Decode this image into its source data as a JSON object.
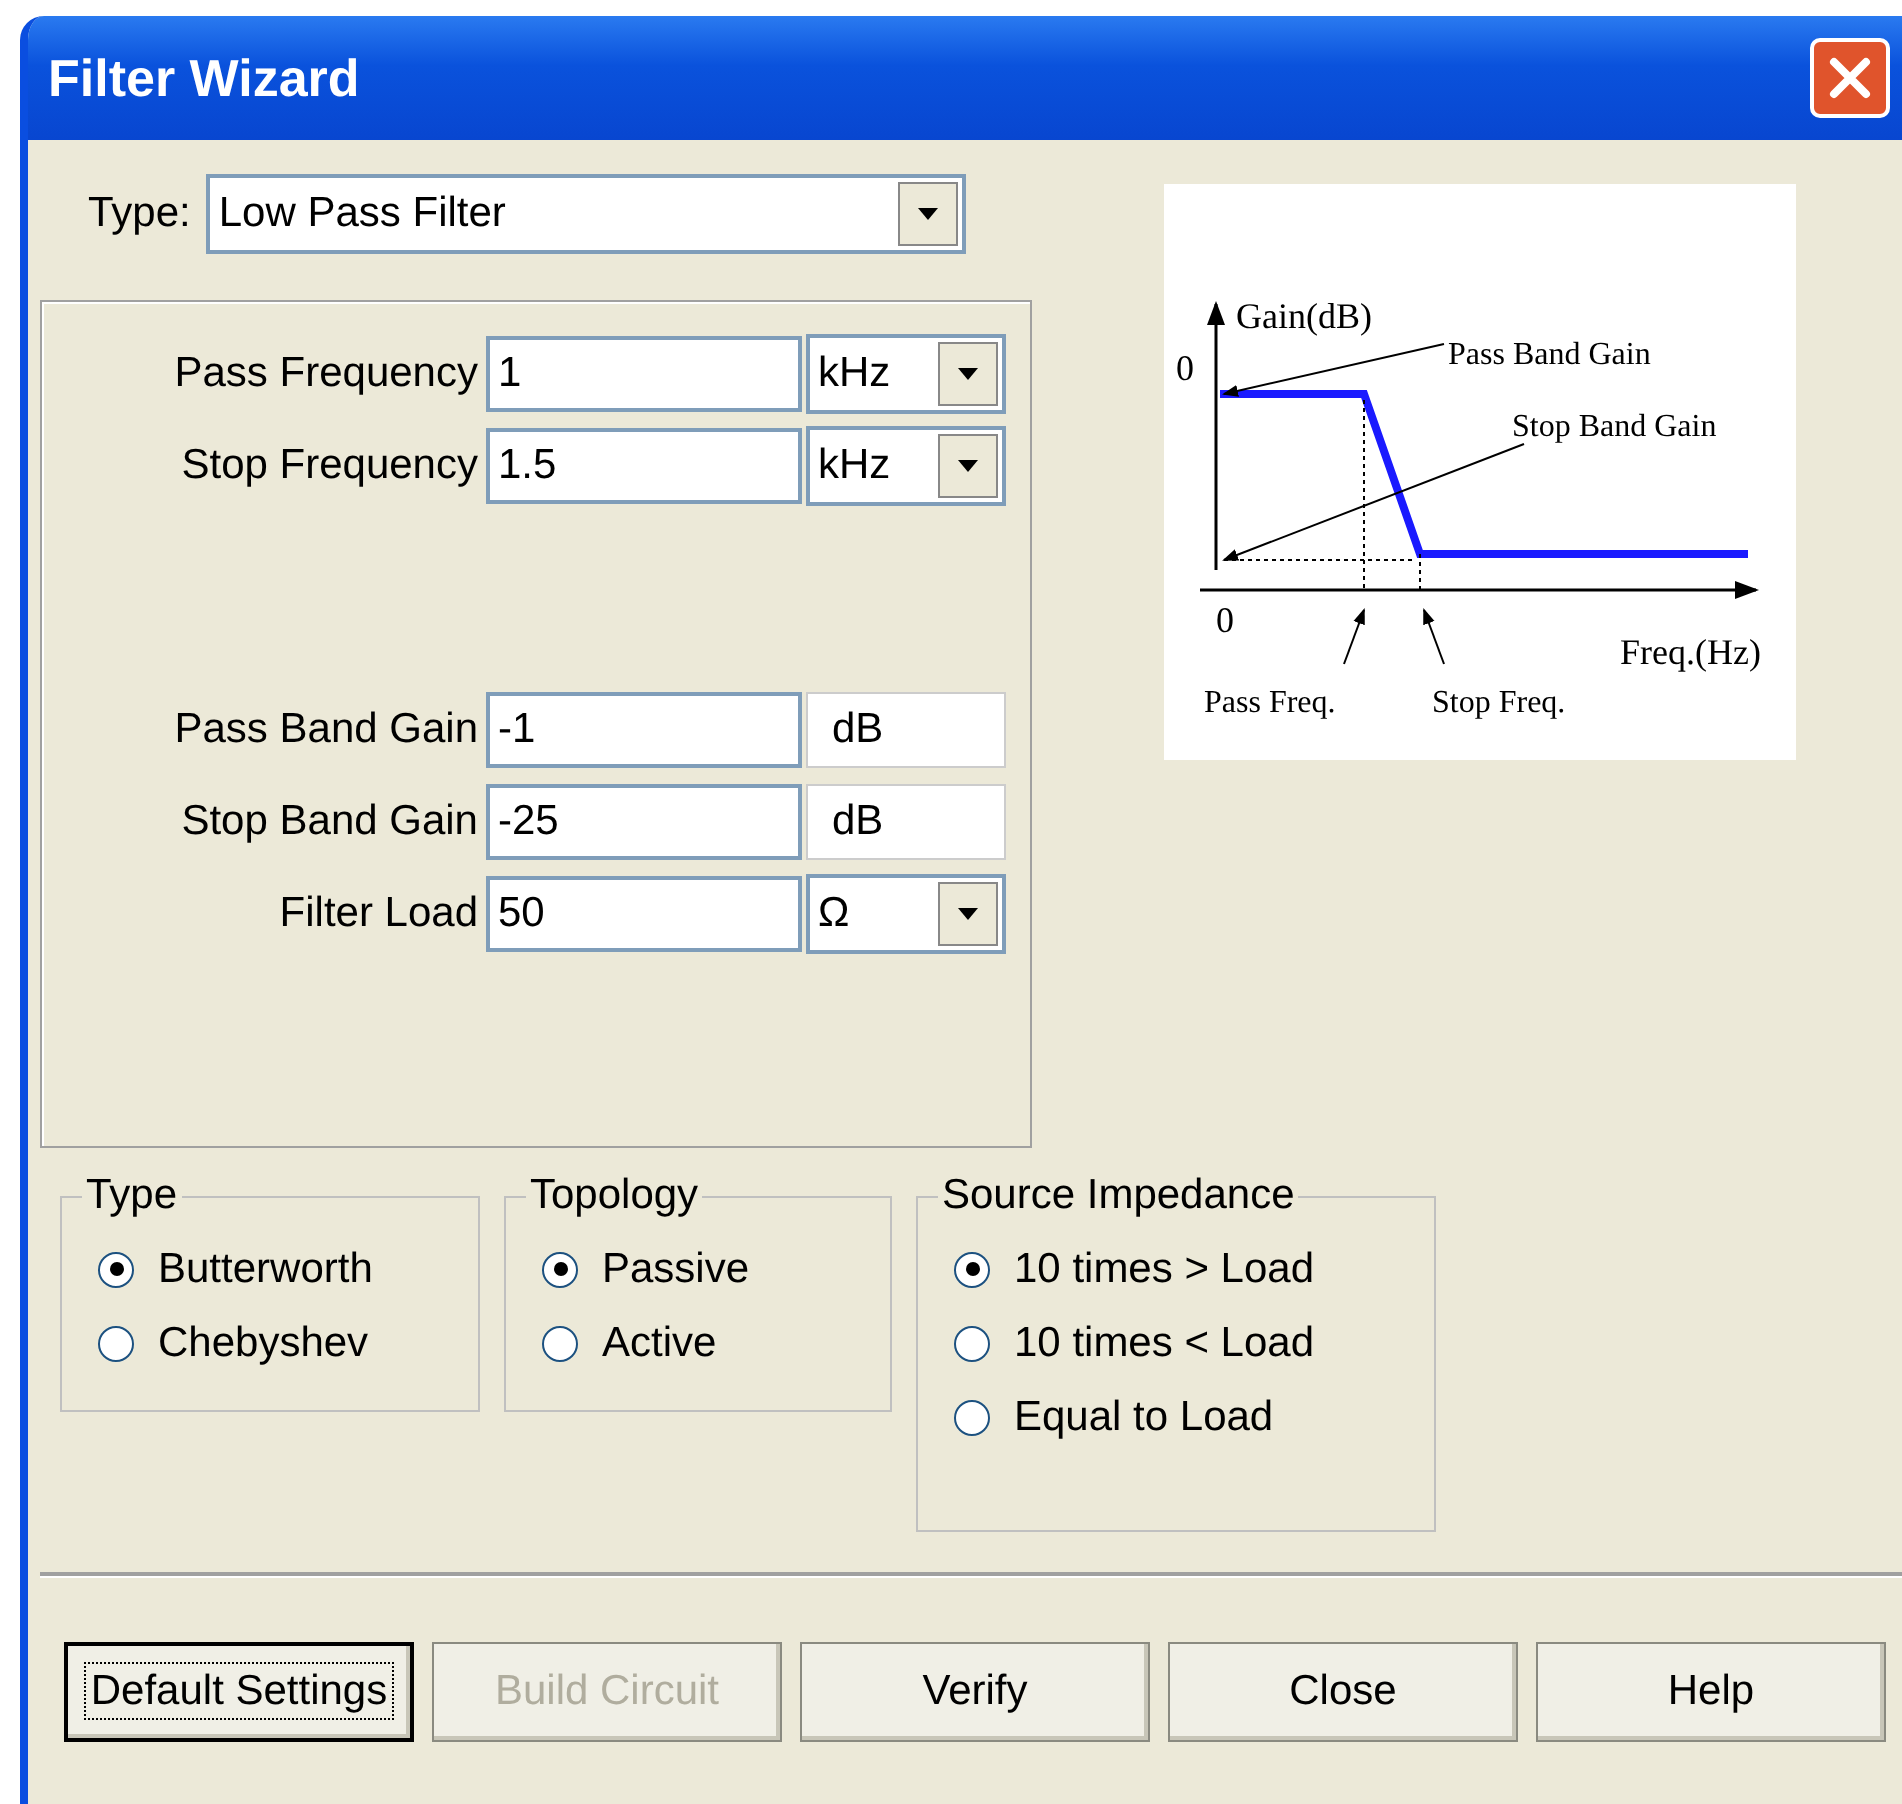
{
  "window": {
    "title": "Filter Wizard"
  },
  "filter_type": {
    "label": "Type:",
    "value": "Low Pass Filter"
  },
  "frequency_fields": [
    {
      "label": "Pass Frequency",
      "value": "1",
      "unit": "kHz",
      "kind": "dropdown"
    },
    {
      "label": "Stop Frequency",
      "value": "1.5",
      "unit": "kHz",
      "kind": "dropdown"
    }
  ],
  "gain_fields": [
    {
      "label": "Pass Band Gain",
      "value": "-1",
      "unit": "dB",
      "kind": "text"
    },
    {
      "label": "Stop Band Gain",
      "value": "-25",
      "unit": "dB",
      "kind": "text"
    },
    {
      "label": "Filter Load",
      "value": "50",
      "unit": "Ω",
      "kind": "dropdown"
    }
  ],
  "diagram": {
    "y_axis": "Gain(dB)",
    "y_zero": "0",
    "x_zero": "0",
    "x_axis": "Freq.(Hz)",
    "pass_band_gain": "Pass Band Gain",
    "stop_band_gain": "Stop Band Gain",
    "pass_freq": "Pass Freq.",
    "stop_freq": "Stop Freq."
  },
  "groups": [
    {
      "title": "Type",
      "options": [
        {
          "label": "Butterworth",
          "selected": true
        },
        {
          "label": "Chebyshev",
          "selected": false
        }
      ]
    },
    {
      "title": "Topology",
      "options": [
        {
          "label": "Passive",
          "selected": true
        },
        {
          "label": "Active",
          "selected": false
        }
      ]
    },
    {
      "title": "Source Impedance",
      "options": [
        {
          "label": "10 times > Load",
          "selected": true
        },
        {
          "label": "10 times < Load",
          "selected": false
        },
        {
          "label": "Equal to Load",
          "selected": false
        }
      ]
    }
  ],
  "buttons": [
    {
      "label": "Default Settings",
      "disabled": false,
      "focused": true
    },
    {
      "label": "Build Circuit",
      "disabled": true,
      "focused": false
    },
    {
      "label": "Verify",
      "disabled": false,
      "focused": false
    },
    {
      "label": "Close",
      "disabled": false,
      "focused": false
    },
    {
      "label": "Help",
      "disabled": false,
      "focused": false
    }
  ]
}
